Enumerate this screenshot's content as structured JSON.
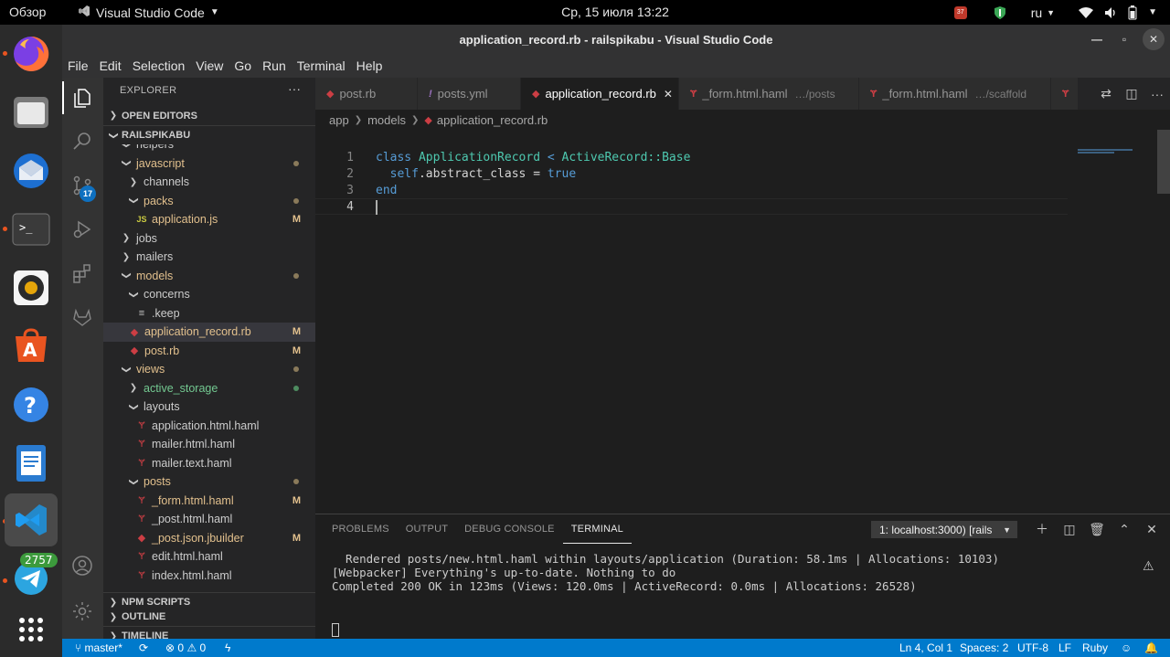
{
  "topbar": {
    "activities": "Обзор",
    "app_name": "Visual Studio Code",
    "clock": "Ср, 15 июля  13:22",
    "tray_badge": "37",
    "keyboard_layout": "ru"
  },
  "dock": {
    "apps": [
      "firefox-icon",
      "files-icon",
      "thunderbird-icon",
      "terminal-icon",
      "rhythmbox-icon",
      "software-icon",
      "help-icon",
      "writer-icon",
      "vscode-icon",
      "telegram-icon",
      "app-grid-icon"
    ],
    "telegram_badge": "2757"
  },
  "window": {
    "title": "application_record.rb - railspikabu - Visual Studio Code"
  },
  "menu": [
    "File",
    "Edit",
    "Selection",
    "View",
    "Go",
    "Run",
    "Terminal",
    "Help"
  ],
  "activity": {
    "scm_badge": "17"
  },
  "explorer": {
    "title": "EXPLORER",
    "more": "···",
    "open_editors": "OPEN EDITORS",
    "project": "RAILSPIKABU",
    "outline": "OUTLINE",
    "timeline": "TIMELINE",
    "npm_scripts": "NPM SCRIPTS",
    "tree": [
      {
        "label": "helpers",
        "depth": 1,
        "kind": "folder-open",
        "status": ""
      },
      {
        "label": "javascript",
        "depth": 1,
        "kind": "folder-open",
        "status": "dot"
      },
      {
        "label": "channels",
        "depth": 2,
        "kind": "folder",
        "status": ""
      },
      {
        "label": "packs",
        "depth": 2,
        "kind": "folder-open",
        "status": "dot"
      },
      {
        "label": "application.js",
        "depth": 3,
        "kind": "js",
        "status": "M"
      },
      {
        "label": "jobs",
        "depth": 1,
        "kind": "folder",
        "status": ""
      },
      {
        "label": "mailers",
        "depth": 1,
        "kind": "folder",
        "status": ""
      },
      {
        "label": "models",
        "depth": 1,
        "kind": "folder-open",
        "status": "dot"
      },
      {
        "label": "concerns",
        "depth": 2,
        "kind": "folder-open",
        "status": ""
      },
      {
        "label": ".keep",
        "depth": 3,
        "kind": "text",
        "status": ""
      },
      {
        "label": "application_record.rb",
        "depth": 2,
        "kind": "ruby",
        "status": "M"
      },
      {
        "label": "post.rb",
        "depth": 2,
        "kind": "ruby",
        "status": "M"
      },
      {
        "label": "views",
        "depth": 1,
        "kind": "folder-open",
        "status": "dot"
      },
      {
        "label": "active_storage",
        "depth": 2,
        "kind": "folder",
        "status": "dot-green"
      },
      {
        "label": "layouts",
        "depth": 2,
        "kind": "folder-open",
        "status": ""
      },
      {
        "label": "application.html.haml",
        "depth": 3,
        "kind": "haml",
        "status": ""
      },
      {
        "label": "mailer.html.haml",
        "depth": 3,
        "kind": "haml",
        "status": ""
      },
      {
        "label": "mailer.text.haml",
        "depth": 3,
        "kind": "haml",
        "status": ""
      },
      {
        "label": "posts",
        "depth": 2,
        "kind": "folder-open",
        "status": "dot"
      },
      {
        "label": "_form.html.haml",
        "depth": 3,
        "kind": "haml",
        "status": "M"
      },
      {
        "label": "_post.html.haml",
        "depth": 3,
        "kind": "haml",
        "status": ""
      },
      {
        "label": "_post.json.jbuilder",
        "depth": 3,
        "kind": "ruby",
        "status": "M"
      },
      {
        "label": "edit.html.haml",
        "depth": 3,
        "kind": "haml",
        "status": ""
      },
      {
        "label": "index.html.haml",
        "depth": 3,
        "kind": "haml",
        "status": ""
      }
    ]
  },
  "tabs": [
    {
      "label": "post.rb",
      "desc": "",
      "icon": "ruby",
      "active": false
    },
    {
      "label": "posts.yml",
      "desc": "",
      "icon": "yaml",
      "active": false
    },
    {
      "label": "application_record.rb",
      "desc": "",
      "icon": "ruby",
      "active": true
    },
    {
      "label": "_form.html.haml",
      "desc": "…/posts",
      "icon": "haml",
      "active": false
    },
    {
      "label": "_form.html.haml",
      "desc": "…/scaffold",
      "icon": "haml",
      "active": false
    }
  ],
  "breadcrumb": [
    "app",
    "models",
    "application_record.rb"
  ],
  "code": {
    "line_numbers": [
      "1",
      "2",
      "3",
      "4"
    ],
    "l1_kw": "class",
    "l1_name": "ApplicationRecord",
    "l1_op": "<",
    "l1_base": "ActiveRecord::Base",
    "l2_self": "self",
    "l2_rest": ".abstract_class = ",
    "l2_true": "true",
    "l3_kw": "end"
  },
  "panel": {
    "tabs": [
      "PROBLEMS",
      "OUTPUT",
      "DEBUG CONSOLE",
      "TERMINAL"
    ],
    "active_tab": "TERMINAL",
    "terminal_select": "1: localhost:3000) [rails",
    "terminal_lines": [
      "  Rendered posts/new.html.haml within layouts/application (Duration: 58.1ms | Allocations: 10103)",
      "[Webpacker] Everything's up-to-date. Nothing to do",
      "Completed 200 OK in 123ms (Views: 120.0ms | ActiveRecord: 0.0ms | Allocations: 26528)"
    ]
  },
  "status": {
    "branch": "master*",
    "errors": "0",
    "warnings": "0",
    "position": "Ln 4, Col 1",
    "spaces": "Spaces: 2",
    "encoding": "UTF-8",
    "eol": "LF",
    "language": "Ruby"
  },
  "colors": {
    "accent": "#007acc",
    "ruby": "#cc3e44",
    "modified": "#e2c08d",
    "untracked": "#73c991"
  }
}
